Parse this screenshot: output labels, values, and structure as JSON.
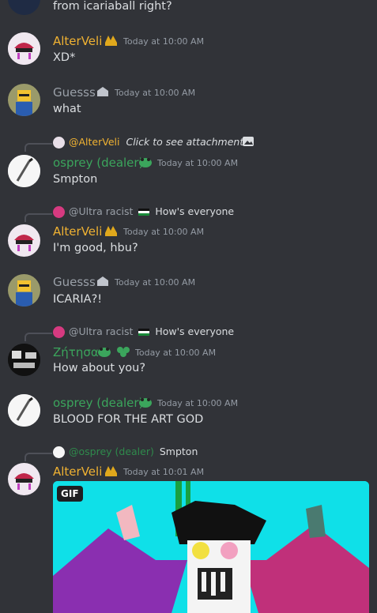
{
  "top_message": {
    "text": "from icariaball right?"
  },
  "messages": [
    {
      "name": "AlterVeli",
      "time": "Today at 10:00 AM",
      "text": "XD*"
    },
    {
      "name": "Guesss",
      "time": "Today at 10:00 AM",
      "text": "what"
    },
    {
      "reply_name": "@AlterVeli",
      "reply_text": "Click to see attachment",
      "name": "osprey (dealer)",
      "time": "Today at 10:00 AM",
      "text": "Smpton"
    },
    {
      "reply_name": "@Ultra racist",
      "reply_text": "How's everyone",
      "name": "AlterVeli",
      "time": "Today at 10:00 AM",
      "text": "I'm good, hbu?"
    },
    {
      "name": "Guesss",
      "time": "Today at 10:00 AM",
      "text": "ICARIA?!"
    },
    {
      "reply_name": "@Ultra racist",
      "reply_text": "How's everyone",
      "name": "Ζήτησα",
      "time": "Today at 10:00 AM",
      "text": "How about you?"
    },
    {
      "name": "osprey (dealer)",
      "time": "Today at 10:00 AM",
      "text": "BLOOD FOR THE ART GOD"
    },
    {
      "reply_name": "@osprey (dealer)",
      "reply_text": "Smpton",
      "name": "AlterVeli",
      "time": "Today at 10:01 AM",
      "attachment_tag": "GIF"
    }
  ],
  "colors": {
    "background": "#313338",
    "alterveli": "#f0b232",
    "guesss": "#9aa0a8",
    "osprey": "#3ba55c",
    "gif_bg": "#0fe0e8"
  }
}
